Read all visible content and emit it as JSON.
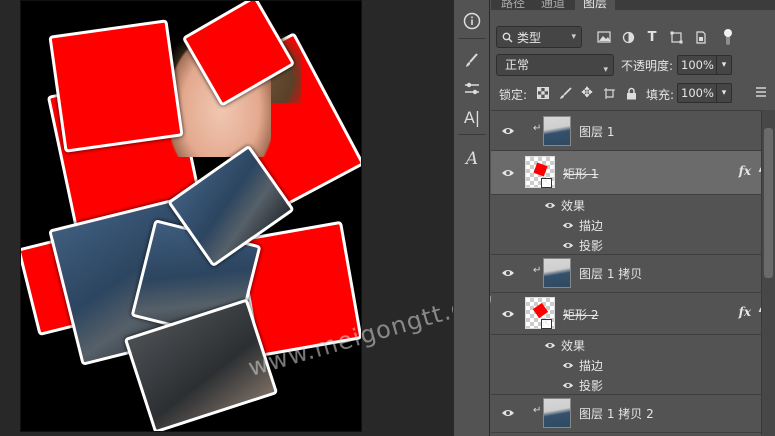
{
  "panel_tabs": [
    "路径",
    "通道",
    "图层"
  ],
  "filter": {
    "kind_label": "类型"
  },
  "blend": {
    "mode": "正常",
    "opacity_label": "不透明度:",
    "opacity_value": "100%"
  },
  "lock": {
    "label": "锁定:",
    "fill_label": "填充:",
    "fill_value": "100%"
  },
  "tools": [
    "info-icon",
    "brush-settings-icon",
    "adjustments-icon",
    "character-icon",
    "glyph-icon"
  ],
  "tool_labels": {
    "character": "A|",
    "glyph": "A"
  },
  "layers": [
    {
      "name": "图层 1",
      "kind": "pixel",
      "clipped": true
    },
    {
      "name": "矩形 1",
      "kind": "shape",
      "has_fx": true,
      "selected": true,
      "fx": "fx",
      "effects_label": "效果",
      "effects": [
        "描边",
        "投影"
      ]
    },
    {
      "name": "图层 1 拷贝",
      "kind": "pixel",
      "clipped": true
    },
    {
      "name": "矩形 2",
      "kind": "shape",
      "has_fx": true,
      "selected": false,
      "fx": "fx",
      "effects_label": "效果",
      "effects": [
        "描边",
        "投影"
      ]
    },
    {
      "name": "图层 1 拷贝 2",
      "kind": "pixel",
      "clipped": true
    }
  ],
  "watermark": "www.meigongtt.com",
  "colors": {
    "accent_red": "#ff0000",
    "panel_bg": "#535353",
    "canvas_bg": "#000000"
  }
}
